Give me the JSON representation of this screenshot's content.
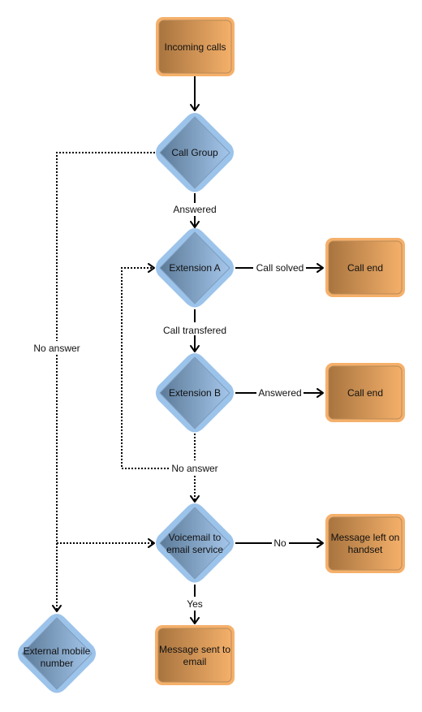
{
  "diagram": {
    "type": "flowchart",
    "colors": {
      "process_fill_start": "#b07d48",
      "process_fill_end": "#f4b06a",
      "process_border": "#f5b06b",
      "decision_fill_start": "#5f7d9b",
      "decision_fill_end": "#9fc2e6",
      "decision_border": "#9cc3ea"
    },
    "nodes": {
      "incoming_calls": {
        "label": "Incoming calls",
        "shape": "process"
      },
      "call_group": {
        "label": "Call Group",
        "shape": "decision"
      },
      "extension_a": {
        "label": "Extension A",
        "shape": "decision"
      },
      "call_end_a": {
        "label": "Call end",
        "shape": "process"
      },
      "extension_b": {
        "label": "Extension B",
        "shape": "decision"
      },
      "call_end_b": {
        "label": "Call end",
        "shape": "process"
      },
      "voicemail_line1": "Voicemail to",
      "voicemail_line2": "email service",
      "message_left_line1": "Message left on",
      "message_left_line2": "handset",
      "external_line1": "External mobile",
      "external_line2": "number",
      "message_sent_line1": "Message sent to",
      "message_sent_line2": "email"
    },
    "edges": [
      {
        "from": "Incoming calls",
        "to": "Call Group",
        "label": "",
        "style": "solid"
      },
      {
        "from": "Call Group",
        "to": "Extension A",
        "label": "Answered",
        "style": "solid"
      },
      {
        "from": "Call Group",
        "to": "External mobile number",
        "label": "No answer",
        "style": "dotted"
      },
      {
        "from": "Extension A",
        "to": "Call end",
        "label": "Call solved",
        "style": "solid"
      },
      {
        "from": "Extension A",
        "to": "Extension B",
        "label": "Call transfered",
        "style": "solid"
      },
      {
        "from": "Extension B",
        "to": "Call end",
        "label": "Answered",
        "style": "solid"
      },
      {
        "from": "Extension B",
        "to": "Extension A",
        "label": "No answer",
        "style": "dotted"
      },
      {
        "from": "Extension B",
        "to": "Voicemail to email service",
        "label": "",
        "style": "dotted"
      },
      {
        "from": "Call Group",
        "to": "Voicemail to email service",
        "label": "",
        "style": "dotted"
      },
      {
        "from": "Voicemail to email service",
        "to": "Message left on handset",
        "label": "No",
        "style": "solid"
      },
      {
        "from": "Voicemail to email service",
        "to": "Message sent to email",
        "label": "Yes",
        "style": "solid"
      }
    ],
    "edge_labels": {
      "answered_1": "Answered",
      "no_answer_left": "No answer",
      "call_solved": "Call solved",
      "call_transfered": "Call transfered",
      "answered_2": "Answered",
      "no_answer_b": "No answer",
      "no": "No",
      "yes": "Yes"
    }
  }
}
